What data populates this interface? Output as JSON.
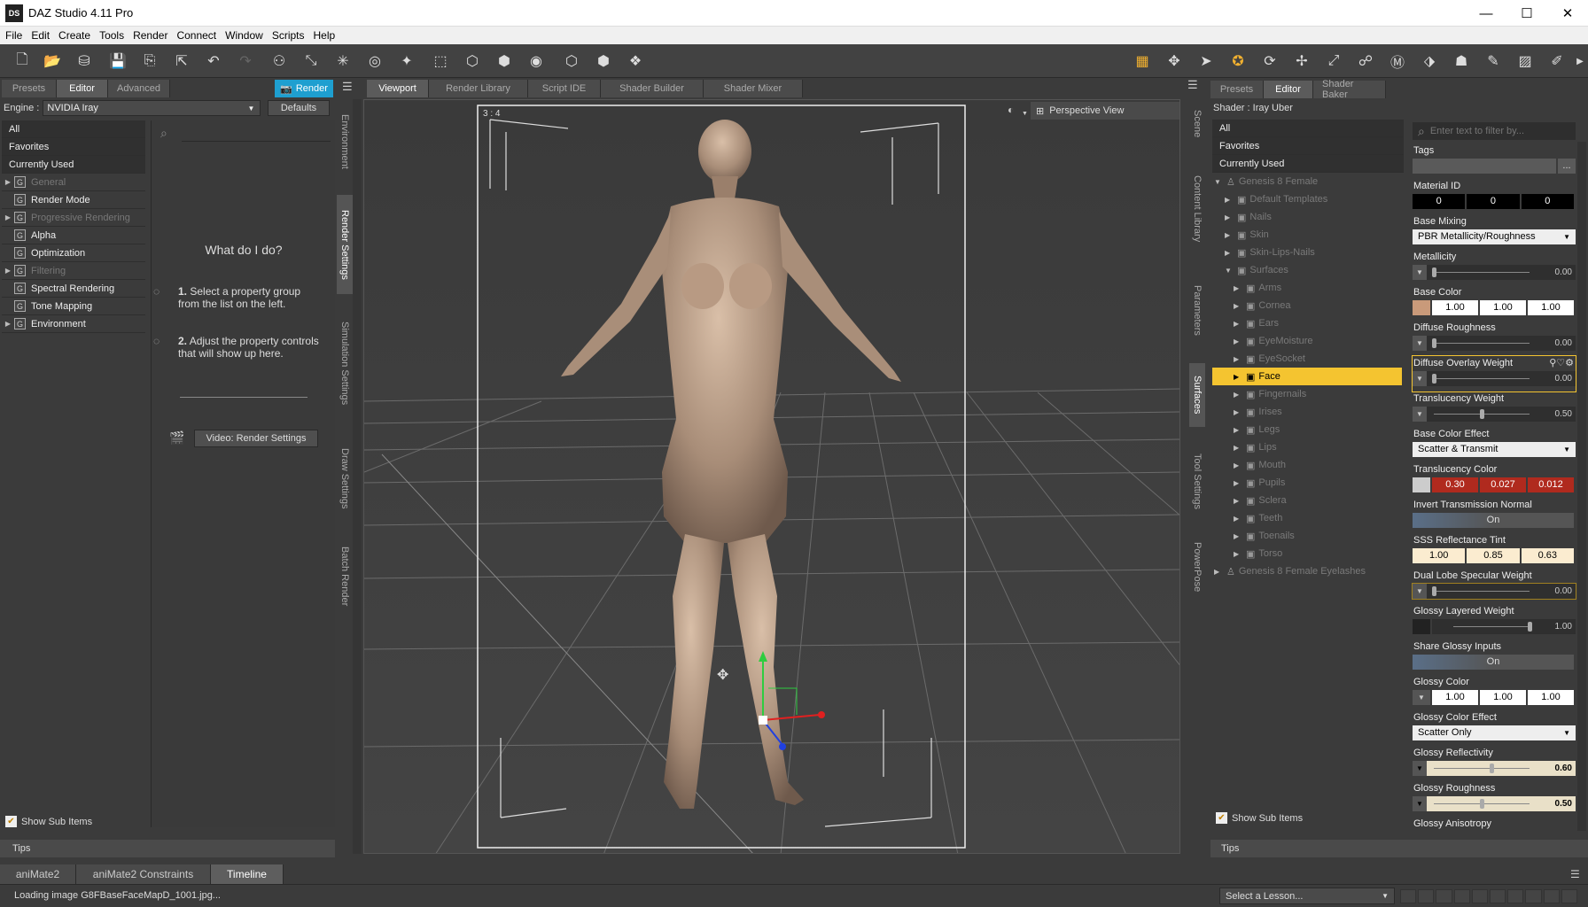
{
  "window": {
    "title": "DAZ Studio 4.11 Pro",
    "logo": "DS"
  },
  "menu": [
    "File",
    "Edit",
    "Create",
    "Tools",
    "Render",
    "Connect",
    "Window",
    "Scripts",
    "Help"
  ],
  "left_panel": {
    "tabs": [
      "Presets",
      "Editor",
      "Advanced"
    ],
    "render_button": "Render",
    "engine_label": "Engine :",
    "engine_value": "NVIDIA Iray",
    "defaults_button": "Defaults",
    "filter_items": [
      "All",
      "Favorites",
      "Currently Used"
    ],
    "groups": [
      {
        "label": "General",
        "dim": true,
        "arrow": true
      },
      {
        "label": "Render Mode",
        "dim": false,
        "arrow": false
      },
      {
        "label": "Progressive Rendering",
        "dim": true,
        "arrow": true
      },
      {
        "label": "Alpha",
        "dim": false,
        "arrow": false
      },
      {
        "label": "Optimization",
        "dim": false,
        "arrow": false
      },
      {
        "label": "Filtering",
        "dim": true,
        "arrow": true
      },
      {
        "label": "Spectral Rendering",
        "dim": false,
        "arrow": false
      },
      {
        "label": "Tone Mapping",
        "dim": false,
        "arrow": false
      },
      {
        "label": "Environment",
        "dim": false,
        "arrow": true
      }
    ],
    "help_title": "What do I do?",
    "help_step1_num": "1.",
    "help_step1": "Select a property group from the list on the left.",
    "help_step2_num": "2.",
    "help_step2": "Adjust the property controls that will show up here.",
    "video_button": "Video: Render Settings",
    "show_sub_items": "Show Sub Items",
    "tips": "Tips",
    "side_tabs": [
      "Environment",
      "Render Settings",
      "Simulation Settings",
      "Draw Settings",
      "Batch Render"
    ]
  },
  "center": {
    "tabs": [
      "Viewport",
      "Render Library",
      "Script IDE",
      "Shader Builder",
      "Shader Mixer"
    ],
    "aspect": "3 : 4",
    "camera": "Perspective View"
  },
  "right_side_tabs": [
    "Scene",
    "Content Library",
    "Parameters",
    "Surfaces",
    "Tool Settings",
    "PowerPose"
  ],
  "surfaces": {
    "tabs": [
      "Presets",
      "Editor",
      "Shader Baker"
    ],
    "shader_label": "Shader : Iray Uber",
    "filter_items": [
      "All",
      "Favorites",
      "Currently Used"
    ],
    "filter_placeholder": "Enter text to filter by...",
    "tree": [
      {
        "label": "Genesis 8 Female",
        "level": 0,
        "arrow": "▼",
        "dim": true
      },
      {
        "label": "Default Templates",
        "level": 1,
        "arrow": "▶",
        "dim": true
      },
      {
        "label": "Nails",
        "level": 1,
        "arrow": "▶",
        "dim": true
      },
      {
        "label": "Skin",
        "level": 1,
        "arrow": "▶",
        "dim": true
      },
      {
        "label": "Skin-Lips-Nails",
        "level": 1,
        "arrow": "▶",
        "dim": true
      },
      {
        "label": "Surfaces",
        "level": 1,
        "arrow": "▼",
        "dim": true
      },
      {
        "label": "Arms",
        "level": 2,
        "arrow": "▶",
        "dim": true
      },
      {
        "label": "Cornea",
        "level": 2,
        "arrow": "▶",
        "dim": true
      },
      {
        "label": "Ears",
        "level": 2,
        "arrow": "▶",
        "dim": true
      },
      {
        "label": "EyeMoisture",
        "level": 2,
        "arrow": "▶",
        "dim": true
      },
      {
        "label": "EyeSocket",
        "level": 2,
        "arrow": "▶",
        "dim": true
      },
      {
        "label": "Face",
        "level": 2,
        "arrow": "▶",
        "dim": false,
        "selected": true
      },
      {
        "label": "Fingernails",
        "level": 2,
        "arrow": "▶",
        "dim": true
      },
      {
        "label": "Irises",
        "level": 2,
        "arrow": "▶",
        "dim": true
      },
      {
        "label": "Legs",
        "level": 2,
        "arrow": "▶",
        "dim": true
      },
      {
        "label": "Lips",
        "level": 2,
        "arrow": "▶",
        "dim": true
      },
      {
        "label": "Mouth",
        "level": 2,
        "arrow": "▶",
        "dim": true
      },
      {
        "label": "Pupils",
        "level": 2,
        "arrow": "▶",
        "dim": true
      },
      {
        "label": "Sclera",
        "level": 2,
        "arrow": "▶",
        "dim": true
      },
      {
        "label": "Teeth",
        "level": 2,
        "arrow": "▶",
        "dim": true
      },
      {
        "label": "Toenails",
        "level": 2,
        "arrow": "▶",
        "dim": true
      },
      {
        "label": "Torso",
        "level": 2,
        "arrow": "▶",
        "dim": true
      },
      {
        "label": "Genesis 8 Female Eyelashes",
        "level": 0,
        "arrow": "▶",
        "dim": true
      }
    ],
    "show_sub_items": "Show Sub Items",
    "tips": "Tips",
    "props": {
      "tags": "Tags",
      "tags_more": "...",
      "material_id": "Material ID",
      "material_id_values": [
        "0",
        "0",
        "0"
      ],
      "base_mixing": "Base Mixing",
      "base_mixing_value": "PBR Metallicity/Roughness",
      "metallicity": "Metallicity",
      "metallicity_value": "0.00",
      "base_color": "Base Color",
      "base_color_values": [
        "1.00",
        "1.00",
        "1.00"
      ],
      "diffuse_roughness": "Diffuse Roughness",
      "diffuse_roughness_value": "0.00",
      "diffuse_overlay_weight": "Diffuse Overlay Weight",
      "diffuse_overlay_weight_value": "0.00",
      "translucency_weight": "Translucency Weight",
      "translucency_weight_value": "0.50",
      "base_color_effect": "Base Color Effect",
      "base_color_effect_value": "Scatter & Transmit",
      "translucency_color": "Translucency Color",
      "translucency_color_values": [
        "0.30",
        "0.027",
        "0.012"
      ],
      "invert_transmission_normal": "Invert Transmission Normal",
      "invert_transmission_normal_value": "On",
      "sss_reflectance_tint": "SSS Reflectance Tint",
      "sss_reflectance_tint_values": [
        "1.00",
        "0.85",
        "0.63"
      ],
      "dual_lobe_specular_weight": "Dual Lobe Specular Weight",
      "dual_lobe_specular_weight_value": "0.00",
      "glossy_layered_weight": "Glossy Layered Weight",
      "glossy_layered_weight_value": "1.00",
      "share_glossy_inputs": "Share Glossy Inputs",
      "share_glossy_inputs_value": "On",
      "glossy_color": "Glossy Color",
      "glossy_color_values": [
        "1.00",
        "1.00",
        "1.00"
      ],
      "glossy_color_effect": "Glossy Color Effect",
      "glossy_color_effect_value": "Scatter Only",
      "glossy_reflectivity": "Glossy Reflectivity",
      "glossy_reflectivity_value": "0.60",
      "glossy_roughness": "Glossy Roughness",
      "glossy_roughness_value": "0.50",
      "glossy_anisotropy": "Glossy Anisotropy"
    },
    "slider_levels": {
      "metallicity": 0,
      "diffuse_roughness": 0,
      "diffuse_overlay_weight": 0,
      "translucency_weight": 0.5,
      "dual_lobe_specular_weight": 0,
      "glossy_layered_weight": 1,
      "glossy_reflectivity": 0.6,
      "glossy_roughness": 0.5
    }
  },
  "bottom": {
    "tabs": [
      "aniMate2",
      "aniMate2 Constraints",
      "Timeline"
    ],
    "status": "Loading image G8FBaseFaceMapD_1001.jpg...",
    "lesson_select": "Select a Lesson..."
  },
  "colors": {
    "accent": "#f4c430",
    "highlight": "#f0b030",
    "render_button": "#1e9fd0"
  }
}
